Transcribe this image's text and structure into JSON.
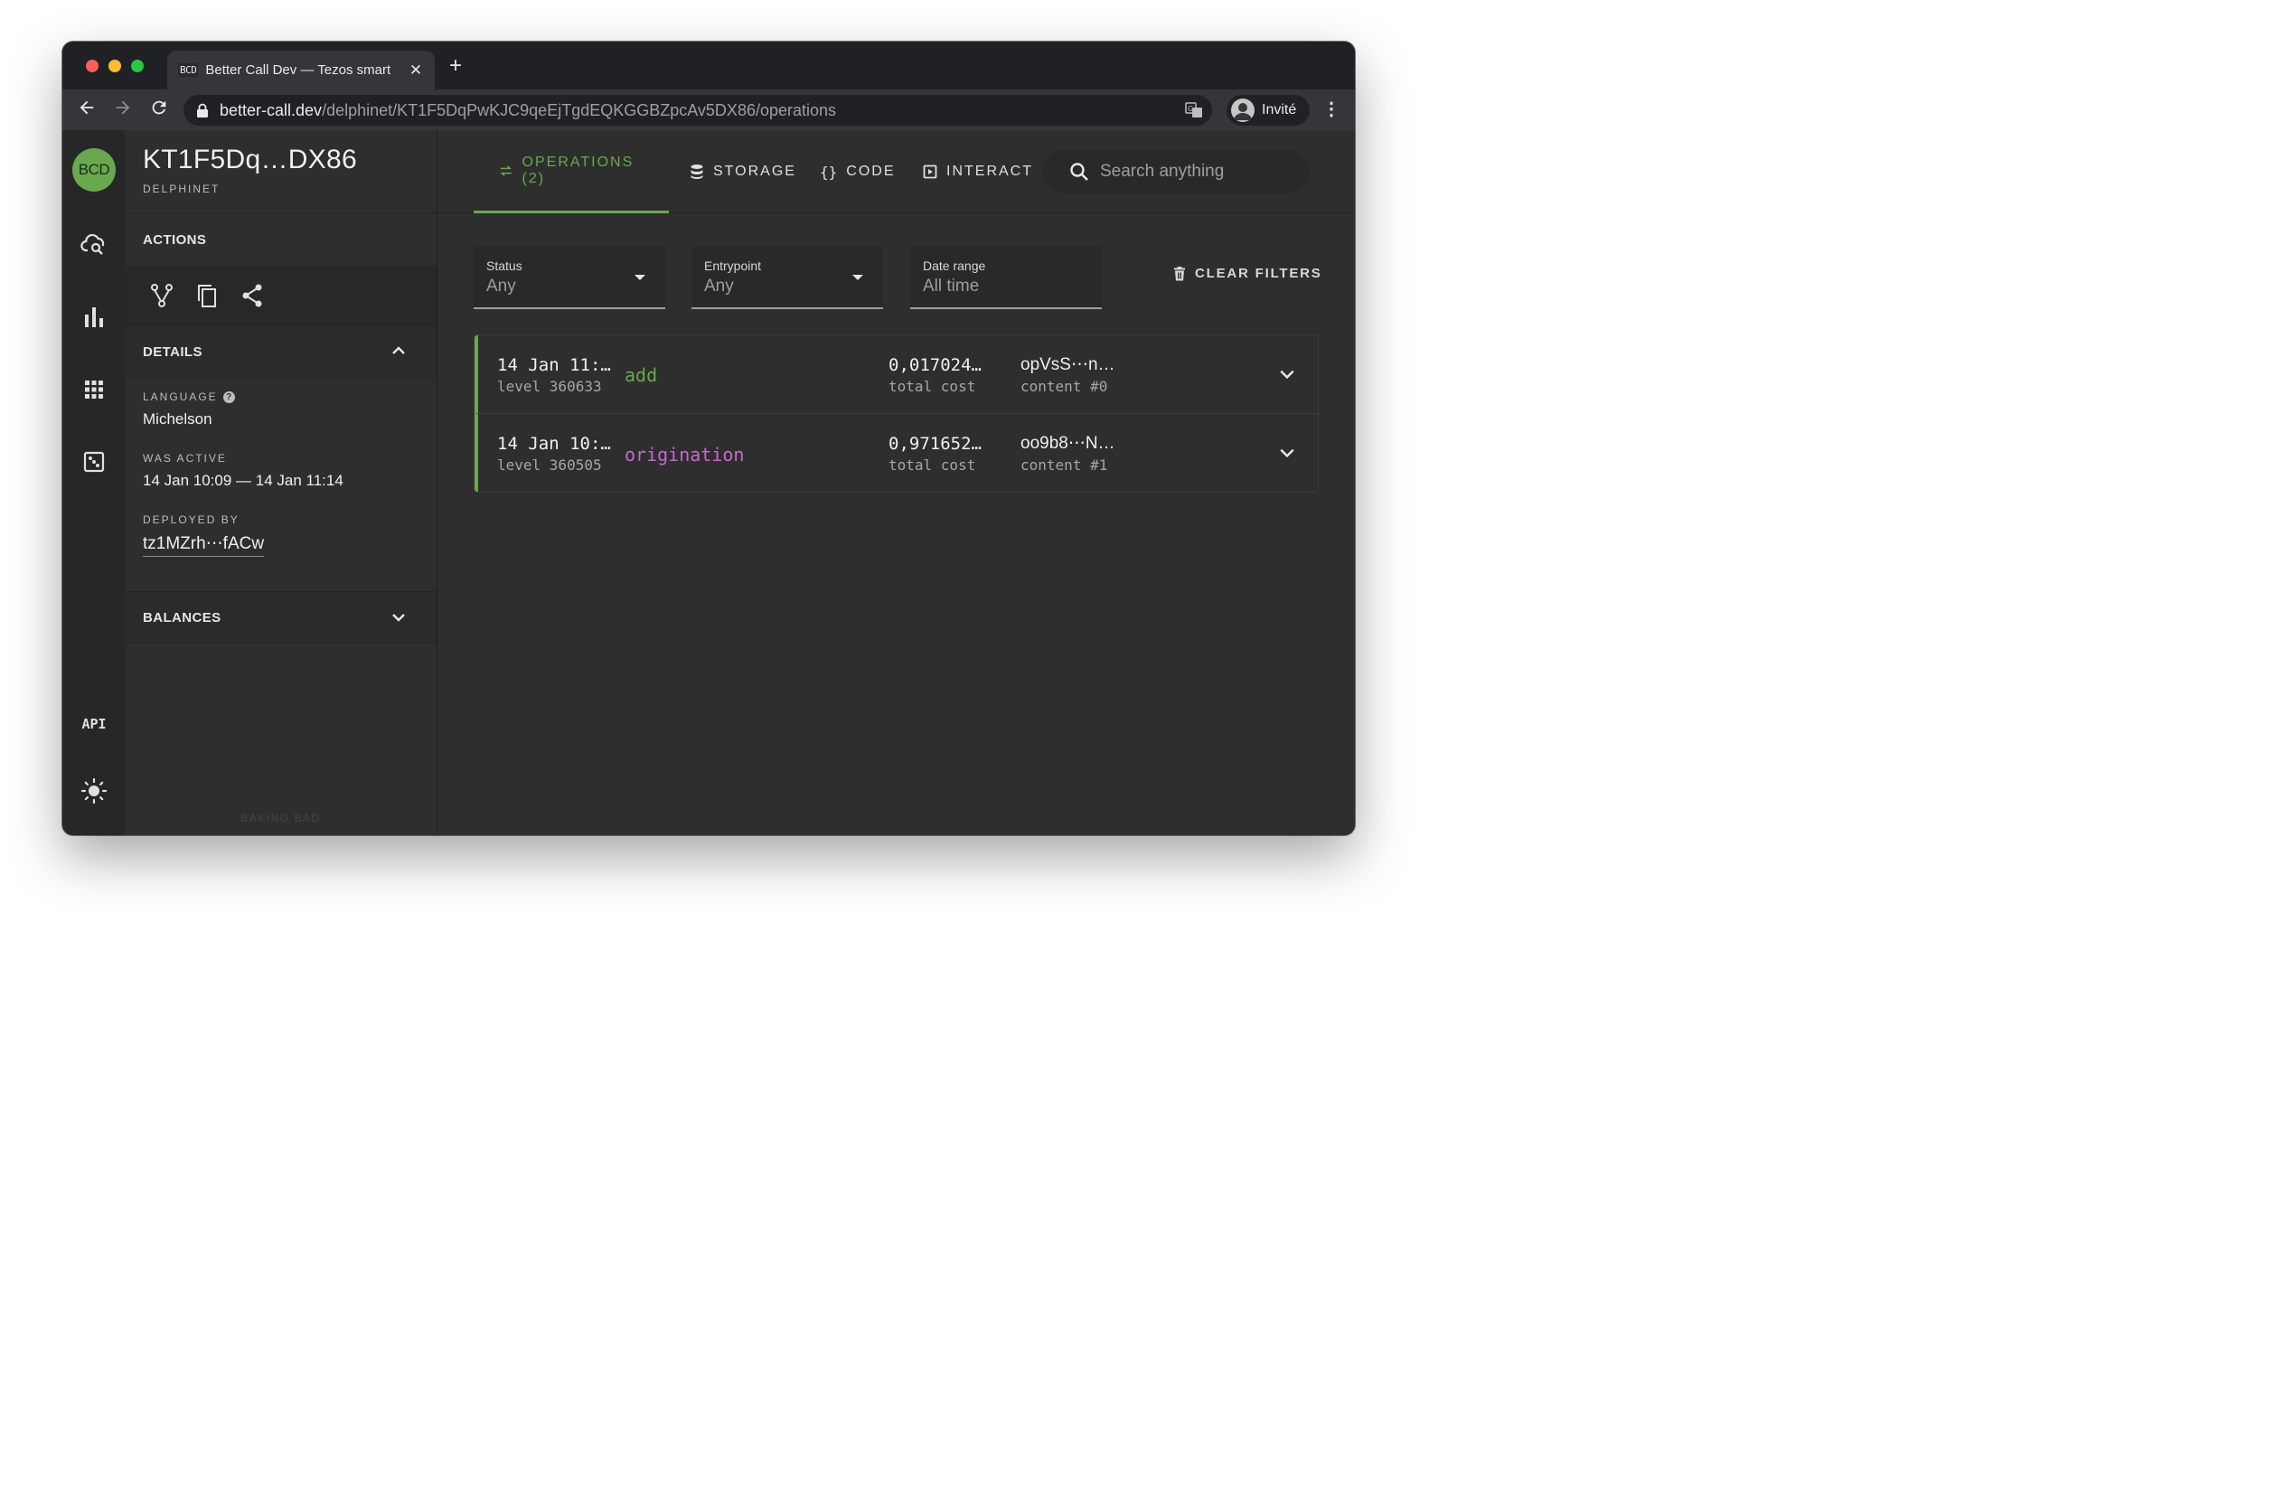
{
  "browser": {
    "tab_favicon": "BCD",
    "tab_title": "Better Call Dev — Tezos smart",
    "tab_close": "✕",
    "new_tab": "+",
    "url_host": "better-call.dev",
    "url_path": "/delphinet/KT1F5DqPwKJC9qeEjTgdEQKGGBZpcAv5DX86/operations",
    "profile_label": "Invité",
    "menu": "⋮"
  },
  "rail": {
    "logo": "BCD",
    "icons": [
      "cloud-search-icon",
      "bar-chart-icon",
      "apps-grid-icon",
      "dice-icon",
      "api-icon",
      "theme-sun-icon"
    ],
    "api_label": "API"
  },
  "sidebar": {
    "contract_title": "KT1F5Dq…DX86",
    "network": "DELPHINET",
    "actions_label": "ACTIONS",
    "action_icons": [
      "fork-icon",
      "copy-icon",
      "share-icon"
    ],
    "details_label": "DETAILS",
    "language_label": "LANGUAGE",
    "language_value": "Michelson",
    "was_active_label": "WAS ACTIVE",
    "was_active_value": "14 Jan 10:09 — 14 Jan 11:14",
    "deployed_by_label": "DEPLOYED BY",
    "deployed_by_value": "tz1MZrh⋯fACw",
    "balances_label": "BALANCES",
    "footer": "BAKING BAD"
  },
  "tabs": [
    {
      "label": "OPERATIONS (2)",
      "icon": "swap-icon",
      "active": true
    },
    {
      "label": "STORAGE",
      "icon": "database-icon",
      "active": false
    },
    {
      "label": "CODE",
      "icon": "braces-icon",
      "active": false
    },
    {
      "label": "INTERACT",
      "icon": "play-box-icon",
      "active": false
    }
  ],
  "search": {
    "placeholder": "Search anything"
  },
  "filters": [
    {
      "label": "Status",
      "value": "Any",
      "dropdown": true
    },
    {
      "label": "Entrypoint",
      "value": "Any",
      "dropdown": true
    },
    {
      "label": "Date range",
      "value": "All time",
      "dropdown": false
    }
  ],
  "clear_filters": "CLEAR FILTERS",
  "operations": [
    {
      "time": "14 Jan 11:…",
      "level": "level 360633",
      "entrypoint": "add",
      "cost": "0,017024…",
      "cost_label": "total cost",
      "hash": "opVsS⋯n…",
      "content": "content #0"
    },
    {
      "time": "14 Jan 10:…",
      "level": "level 360505",
      "entrypoint": "origination",
      "cost": "0,971652…",
      "cost_label": "total cost",
      "hash": "oo9b8⋯N…",
      "content": "content #1"
    }
  ],
  "colors": {
    "accent_green": "#6aa84f",
    "origination_purple": "#c46bcf",
    "background": "#2e2e2e"
  }
}
